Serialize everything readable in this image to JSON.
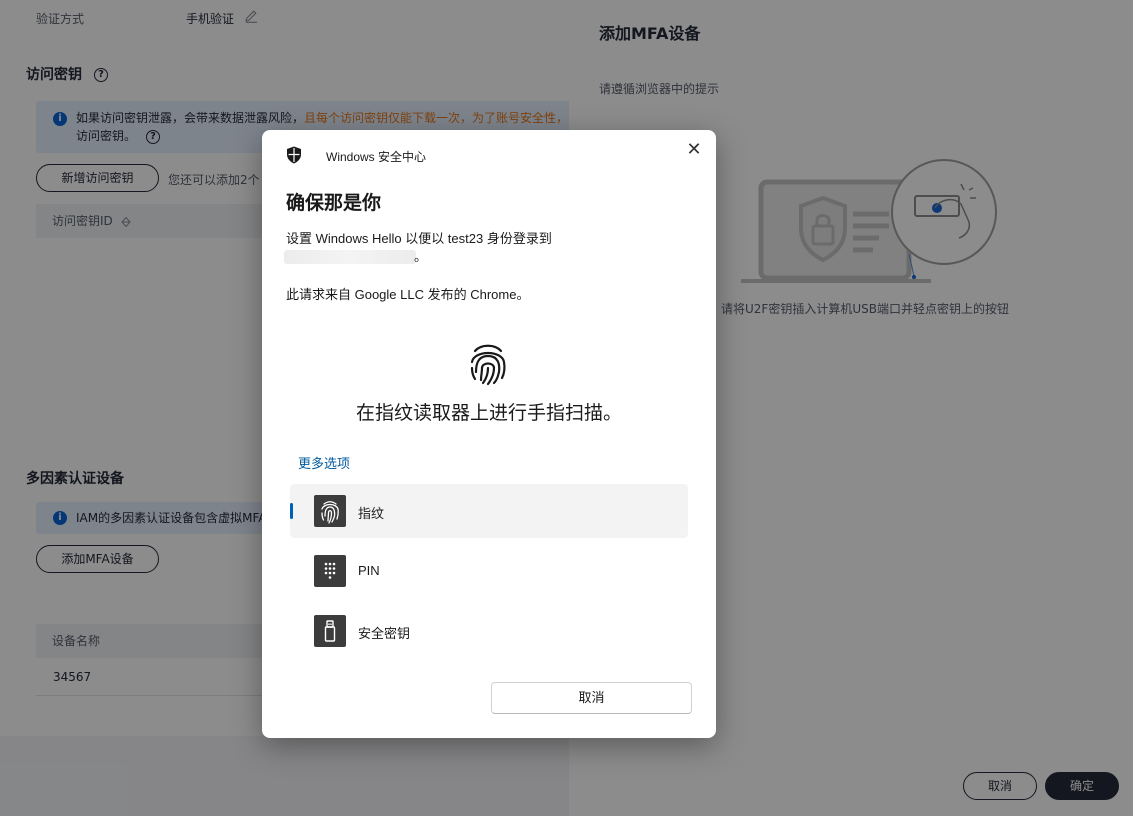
{
  "background_page": {
    "verify_method_label": "验证方式",
    "verify_method_value": "手机验证",
    "access_key_section_title": "访问密钥",
    "access_key_info_normal": "如果访问密钥泄露，会带来数据泄露风险，",
    "access_key_info_warning": "且每个访问密钥仅能下载一次，为了账号安全性，",
    "access_key_info_line2": "访问密钥。",
    "add_access_key_button": "新增访问密钥",
    "add_access_key_note": "您还可以添加2个",
    "access_key_table_header": "访问密钥ID",
    "mfa_section_title": "多因素认证设备",
    "mfa_info": "IAM的多因素认证设备包含虚拟MFA",
    "add_mfa_button": "添加MFA设备",
    "mfa_table_header": "设备名称",
    "mfa_table_rows": [
      "34567"
    ]
  },
  "side_panel": {
    "title": "添加MFA设备",
    "hint": "请遵循浏览器中的提示",
    "illustration_caption": "请将U2F密钥插入计算机USB端口并轻点密钥上的按钮",
    "cancel_button": "取消",
    "confirm_button": "确定"
  },
  "dialog": {
    "app_name": "Windows 安全中心",
    "close_symbol": "✕",
    "heading": "确保那是你",
    "setup_text": "设置 Windows Hello 以便以 test23 身份登录到",
    "period": "。",
    "request_text": "此请求来自 Google LLC 发布的 Chrome。",
    "scan_instruction": "在指纹读取器上进行手指扫描。",
    "more_options": "更多选项",
    "options": [
      {
        "label": "指纹",
        "icon": "fingerprint-icon",
        "selected": true
      },
      {
        "label": "PIN",
        "icon": "keypad-icon",
        "selected": false
      },
      {
        "label": "安全密钥",
        "icon": "usb-key-icon",
        "selected": false
      }
    ],
    "cancel_button": "取消"
  },
  "colors": {
    "accent_blue": "#005fb8",
    "link_blue": "#005a9e",
    "warning_orange": "#e5781c",
    "info_bg": "#e6f1ff"
  }
}
